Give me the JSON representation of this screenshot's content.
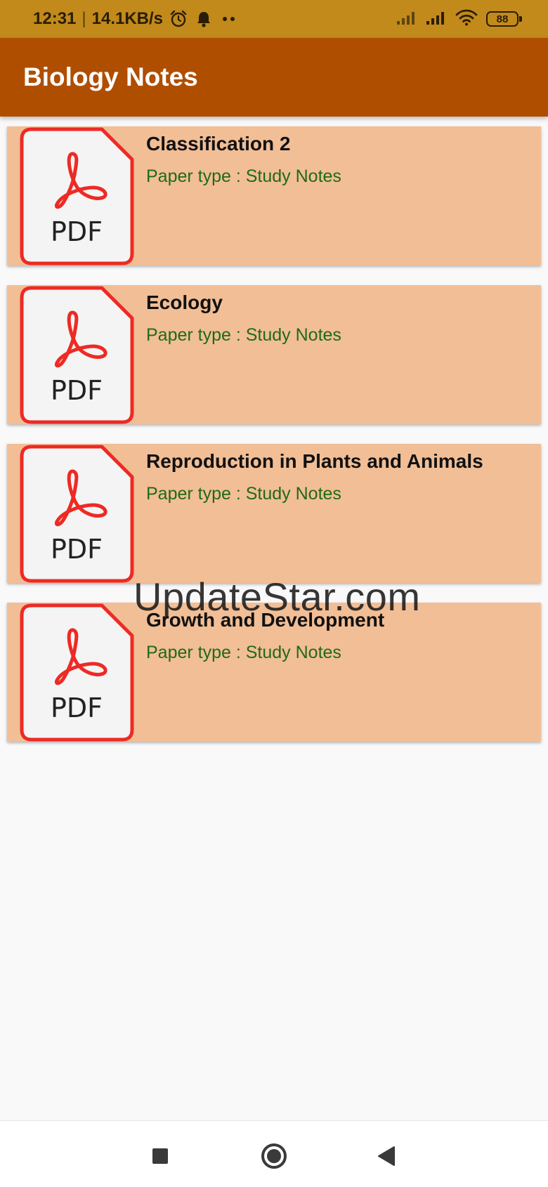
{
  "status_bar": {
    "time": "12:31",
    "separator": "|",
    "speed": "14.1KB/s",
    "battery": "88",
    "icons": [
      "alarm-icon",
      "bell-icon",
      "more-dots-icon",
      "signal-icon",
      "wifi-icon",
      "battery-icon"
    ]
  },
  "app_bar": {
    "title": "Biology Notes"
  },
  "colors": {
    "status_bar": "#c28a1a",
    "app_bar": "#b04e00",
    "card": "#f2be96",
    "paper_type_text": "#1f6b12",
    "pdf_red": "#ee2a24"
  },
  "pdf_label": "PDF",
  "notes": [
    {
      "title": "Classification 2",
      "type": "Paper type : Study Notes"
    },
    {
      "title": "Ecology",
      "type": "Paper type : Study Notes"
    },
    {
      "title": "Reproduction in Plants and Animals",
      "type": "Paper type : Study Notes"
    },
    {
      "title": "Growth and Development",
      "type": "Paper type : Study Notes"
    }
  ],
  "watermark": "UpdateStar.com",
  "nav_bar": {
    "icons": [
      "recents-square-icon",
      "home-circle-icon",
      "back-triangle-icon"
    ]
  }
}
